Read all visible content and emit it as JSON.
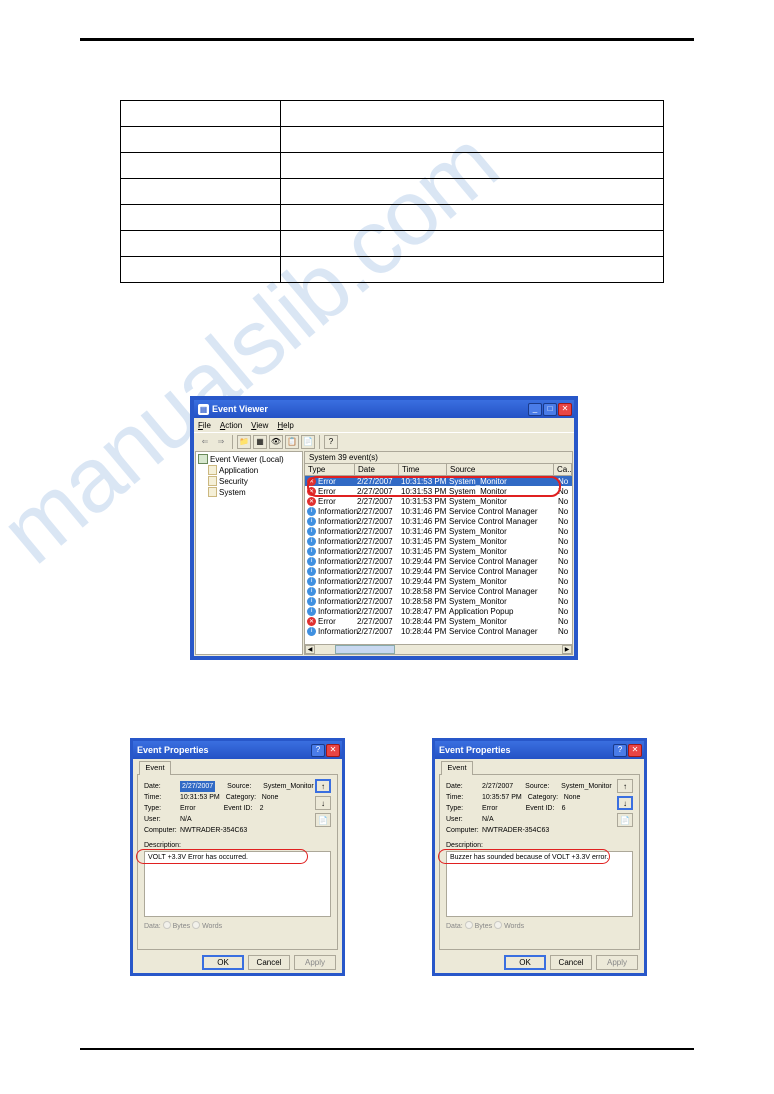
{
  "watermark": "manualslib.com",
  "ev": {
    "title": "Event Viewer",
    "menu": [
      "File",
      "Action",
      "View",
      "Help"
    ],
    "tree": {
      "root": "Event Viewer (Local)",
      "children": [
        "Application",
        "Security",
        "System"
      ]
    },
    "list_caption": "System    39 event(s)",
    "headers": {
      "type": "Type",
      "date": "Date",
      "time": "Time",
      "source": "Source",
      "ca": "Ca..."
    },
    "rows": [
      {
        "icon": "error",
        "selected": true,
        "type": "Error",
        "date": "2/27/2007",
        "time": "10:31:53 PM",
        "source": "System_Monitor",
        "ca": "No"
      },
      {
        "icon": "error",
        "type": "Error",
        "date": "2/27/2007",
        "time": "10:31:53 PM",
        "source": "System_Monitor",
        "ca": "No"
      },
      {
        "icon": "error",
        "type": "Error",
        "date": "2/27/2007",
        "time": "10:31:53 PM",
        "source": "System_Monitor",
        "ca": "No"
      },
      {
        "icon": "info",
        "type": "Information",
        "date": "2/27/2007",
        "time": "10:31:46 PM",
        "source": "Service Control Manager",
        "ca": "No"
      },
      {
        "icon": "info",
        "type": "Information",
        "date": "2/27/2007",
        "time": "10:31:46 PM",
        "source": "Service Control Manager",
        "ca": "No"
      },
      {
        "icon": "info",
        "type": "Information",
        "date": "2/27/2007",
        "time": "10:31:46 PM",
        "source": "System_Monitor",
        "ca": "No"
      },
      {
        "icon": "info",
        "type": "Information",
        "date": "2/27/2007",
        "time": "10:31:45 PM",
        "source": "System_Monitor",
        "ca": "No"
      },
      {
        "icon": "info",
        "type": "Information",
        "date": "2/27/2007",
        "time": "10:31:45 PM",
        "source": "System_Monitor",
        "ca": "No"
      },
      {
        "icon": "info",
        "type": "Information",
        "date": "2/27/2007",
        "time": "10:29:44 PM",
        "source": "Service Control Manager",
        "ca": "No"
      },
      {
        "icon": "info",
        "type": "Information",
        "date": "2/27/2007",
        "time": "10:29:44 PM",
        "source": "Service Control Manager",
        "ca": "No"
      },
      {
        "icon": "info",
        "type": "Information",
        "date": "2/27/2007",
        "time": "10:29:44 PM",
        "source": "System_Monitor",
        "ca": "No"
      },
      {
        "icon": "info",
        "type": "Information",
        "date": "2/27/2007",
        "time": "10:28:58 PM",
        "source": "Service Control Manager",
        "ca": "No"
      },
      {
        "icon": "info",
        "type": "Information",
        "date": "2/27/2007",
        "time": "10:28:58 PM",
        "source": "System_Monitor",
        "ca": "No"
      },
      {
        "icon": "info",
        "type": "Information",
        "date": "2/27/2007",
        "time": "10:28:47 PM",
        "source": "Application Popup",
        "ca": "No"
      },
      {
        "icon": "error",
        "type": "Error",
        "date": "2/27/2007",
        "time": "10:28:44 PM",
        "source": "System_Monitor",
        "ca": "No"
      },
      {
        "icon": "info",
        "type": "Information",
        "date": "2/27/2007",
        "time": "10:28:44 PM",
        "source": "Service Control Manager",
        "ca": "No"
      }
    ]
  },
  "ep_common": {
    "title": "Event Properties",
    "tab": "Event",
    "labels": {
      "date": "Date:",
      "time": "Time:",
      "type": "Type:",
      "user": "User:",
      "computer": "Computer:",
      "source": "Source:",
      "category": "Category:",
      "eventid": "Event ID:",
      "description": "Description:",
      "bytes": "Bytes",
      "words": "Words",
      "data": "Data:"
    },
    "buttons": {
      "ok": "OK",
      "cancel": "Cancel",
      "apply": "Apply"
    },
    "nav": {
      "up": "↑",
      "down": "↓",
      "copy": "📄"
    }
  },
  "ep1": {
    "date": "2/27/2007",
    "time": "10:31:53 PM",
    "type": "Error",
    "user": "N/A",
    "computer": "NWTRADER-354C63",
    "source": "System_Monitor",
    "category": "None",
    "eventid": "2",
    "description": "VOLT +3.3V Error has occurred."
  },
  "ep2": {
    "date": "2/27/2007",
    "time": "10:35:57 PM",
    "type": "Error",
    "user": "N/A",
    "computer": "NWTRADER-354C63",
    "source": "System_Monitor",
    "category": "None",
    "eventid": "6",
    "description": "Buzzer has sounded because of VOLT +3.3V error."
  }
}
